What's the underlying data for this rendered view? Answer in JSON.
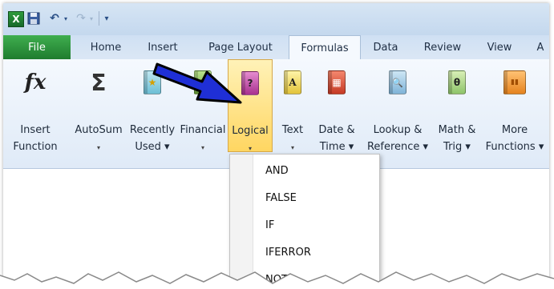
{
  "qat": {
    "app_icon": "excel-icon",
    "undo_glyph": "↶",
    "redo_glyph": "↷",
    "drop_glyph": "▾",
    "custom_glyph": "⏷"
  },
  "tabs": [
    {
      "label": "File"
    },
    {
      "label": "Home"
    },
    {
      "label": "Insert"
    },
    {
      "label": "Page Layout"
    },
    {
      "label": "Formulas"
    },
    {
      "label": "Data"
    },
    {
      "label": "Review"
    },
    {
      "label": "View"
    },
    {
      "label": "A"
    }
  ],
  "ribbon": {
    "insert_function": {
      "line1": "Insert",
      "line2": "Function"
    },
    "autosum": {
      "line1": "AutoSum",
      "line2": "▾"
    },
    "recently_used": {
      "line1": "Recently",
      "line2": "Used ▾"
    },
    "financial": {
      "line1": "Financial",
      "line2": "▾"
    },
    "logical": {
      "line1": "Logical",
      "line2": "▾"
    },
    "text": {
      "line1": "Text",
      "line2": "▾"
    },
    "date_time": {
      "line1": "Date &",
      "line2": "Time ▾"
    },
    "lookup": {
      "line1": "Lookup &",
      "line2": "Reference ▾"
    },
    "math": {
      "line1": "Math &",
      "line2": "Trig ▾"
    },
    "more": {
      "line1": "More",
      "line2": "Functions ▾"
    },
    "glyphs": {
      "fx": "fx",
      "sigma": "Σ",
      "star": "★",
      "coin": "$",
      "question": "?",
      "text_a": "A",
      "calendar": "▦",
      "magnifier": "🔍",
      "theta": "θ",
      "books": "▮▮"
    }
  },
  "logical_menu": {
    "items": [
      "AND",
      "FALSE",
      "IF",
      "IFERROR",
      "NOT"
    ]
  },
  "colors": {
    "file_tab": "#2c8f3c",
    "logical_highlight": "#ffd661",
    "arrow_fill": "#1f2fd6"
  }
}
